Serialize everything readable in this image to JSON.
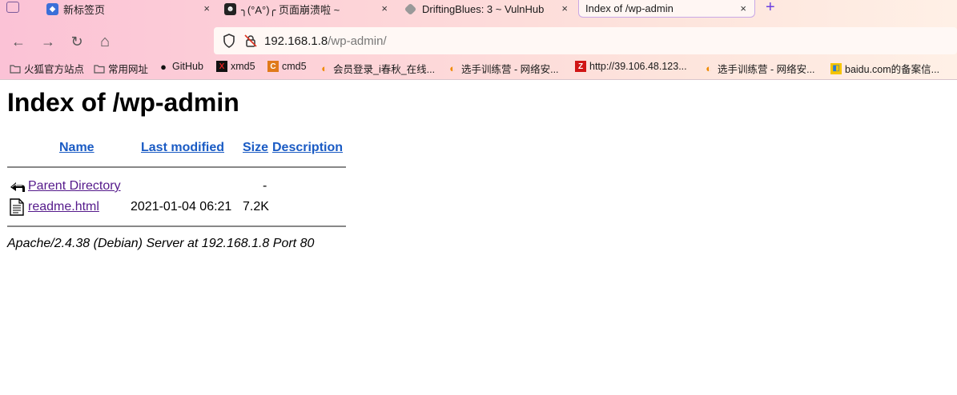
{
  "tabs": [
    {
      "label": "新标签页",
      "icon": "newtab-icon",
      "color": "#3b6fd8"
    },
    {
      "label": "╮(°A°)╭ 页面崩溃啦 ~",
      "icon": "avatar-icon",
      "color": "#222222"
    },
    {
      "label": "DriftingBlues: 3 ~ VulnHub",
      "icon": "vulnhub-icon",
      "color": "#888888"
    },
    {
      "label": "Index of /wp-admin",
      "icon": "",
      "color": "",
      "active": true
    }
  ],
  "tab_close_glyph": "×",
  "new_tab_glyph": "+",
  "nav": {
    "back_glyph": "←",
    "forward_glyph": "→",
    "reload_glyph": "↻",
    "home_glyph": "⌂",
    "url_host": "192.168.1.8",
    "url_path": "/wp-admin/"
  },
  "bookmarks": [
    {
      "label": "火狐官方站点",
      "icon": "folder-icon",
      "glyph": "",
      "color": "#555555"
    },
    {
      "label": "常用网址",
      "icon": "folder-icon",
      "glyph": "",
      "color": "#555555"
    },
    {
      "label": "GitHub",
      "icon": "github-icon",
      "glyph": "●",
      "color": "#111111"
    },
    {
      "label": "xmd5",
      "icon": "xmd5-icon",
      "glyph": "X",
      "color": "#cc0000"
    },
    {
      "label": "cmd5",
      "icon": "cmd5-icon",
      "glyph": "C",
      "color": "#e07a1a"
    },
    {
      "label": "会员登录_i春秋_在线...",
      "icon": "ichunqiu-icon",
      "glyph": "◐",
      "color": "#f08a00"
    },
    {
      "label": "选手训练营 - 网络安...",
      "icon": "ichunqiu-icon",
      "glyph": "◐",
      "color": "#f08a00"
    },
    {
      "label": "http://39.106.48.123...",
      "icon": "zblog-icon",
      "glyph": "Z",
      "color": "#d01515"
    },
    {
      "label": "选手训练营 - 网络安...",
      "icon": "ichunqiu-icon",
      "glyph": "◐",
      "color": "#f08a00"
    },
    {
      "label": "baidu.com的备案信...",
      "icon": "beian-icon",
      "glyph": "◧",
      "color": "#2a7ad0"
    }
  ],
  "page": {
    "title": "Index of /wp-admin",
    "columns": {
      "name": "Name",
      "modified": "Last modified",
      "size": "Size",
      "description": "Description"
    },
    "rows": [
      {
        "icon": "back-arrow-icon",
        "name": "Parent Directory",
        "modified": "",
        "size": "-",
        "description": ""
      },
      {
        "icon": "text-file-icon",
        "name": "readme.html",
        "modified": "2021-01-04 06:21",
        "size": "7.2K",
        "description": ""
      }
    ],
    "footer": "Apache/2.4.38 (Debian) Server at 192.168.1.8 Port 80"
  }
}
